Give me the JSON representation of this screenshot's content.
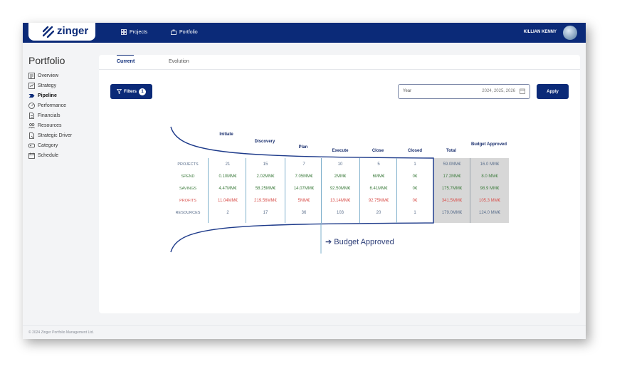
{
  "app": {
    "logo_text": "zinger",
    "user_name": "KILLIAN KENNY"
  },
  "topnav": [
    {
      "label": "Projects",
      "icon": "grid-icon"
    },
    {
      "label": "Portfolio",
      "icon": "briefcase-icon"
    }
  ],
  "page_title": "Portfolio",
  "sidebar": {
    "items": [
      {
        "label": "Overview",
        "icon": "overview-icon",
        "active": false
      },
      {
        "label": "Strategy",
        "icon": "strategy-icon",
        "active": false
      },
      {
        "label": "Pipeline",
        "icon": "pipeline-icon",
        "active": true
      },
      {
        "label": "Performance",
        "icon": "gauge-icon",
        "active": false
      },
      {
        "label": "Financials",
        "icon": "document-icon",
        "active": false
      },
      {
        "label": "Resources",
        "icon": "people-icon",
        "active": false
      },
      {
        "label": "Strategic Driver",
        "icon": "driver-icon",
        "active": false
      },
      {
        "label": "Category",
        "icon": "tag-icon",
        "active": false
      },
      {
        "label": "Schedule",
        "icon": "calendar-icon",
        "active": false
      }
    ]
  },
  "tabs": [
    {
      "label": "Current",
      "active": true
    },
    {
      "label": "Evolution",
      "active": false
    }
  ],
  "filters": {
    "label": "Filters",
    "count": "1"
  },
  "year_filter": {
    "label": "Year",
    "value": "2024, 2025, 2026"
  },
  "apply_label": "Apply",
  "pipeline": {
    "stages": [
      "Initiate",
      "Discovery",
      "Plan",
      "Execute",
      "Close",
      "Closed"
    ],
    "summary_columns": [
      "Total",
      "Budget Approved"
    ],
    "rows": [
      {
        "label": "PROJECTS",
        "color": "#5b6f8c",
        "values": [
          "21",
          "15",
          "7",
          "10",
          "5",
          "1"
        ],
        "total": "59.0MM€",
        "budget": "16.0 MM€"
      },
      {
        "label": "SPEND",
        "color": "#3f7d3f",
        "values": [
          "0.10MM€",
          "2.02MM€",
          "7.05MM€",
          "2MM€",
          "6MM€",
          "0€"
        ],
        "total": "17.2MM€",
        "budget": "8.0 MM€"
      },
      {
        "label": "SAVINGS",
        "color": "#3f7d3f",
        "values": [
          "4.47MM€",
          "58.25MM€",
          "14.07MM€",
          "92.50MM€",
          "6.41MM€",
          "0€"
        ],
        "total": "175.7MM€",
        "budget": "98.9 MM€"
      },
      {
        "label": "PROFITS",
        "color": "#d9534f",
        "values": [
          "11.04MM€",
          "219.56MM€",
          "5MM€",
          "13.14MM€",
          "92.75MM€",
          "0€"
        ],
        "total": "341.5MM€",
        "budget": "105.3 MM€"
      },
      {
        "label": "RESOURCES",
        "color": "#5b6f8c",
        "values": [
          "2",
          "17",
          "36",
          "103",
          "20",
          "1"
        ],
        "total": "179.0MM€",
        "budget": "124.0 MM€"
      }
    ],
    "budget_marker": "Budget Approved"
  },
  "footer": "© 2024 Zinger Portfolio Management Ltd.",
  "colors": {
    "brand": "#0b2a78",
    "positive": "#3f7d3f",
    "negative": "#d9534f"
  }
}
